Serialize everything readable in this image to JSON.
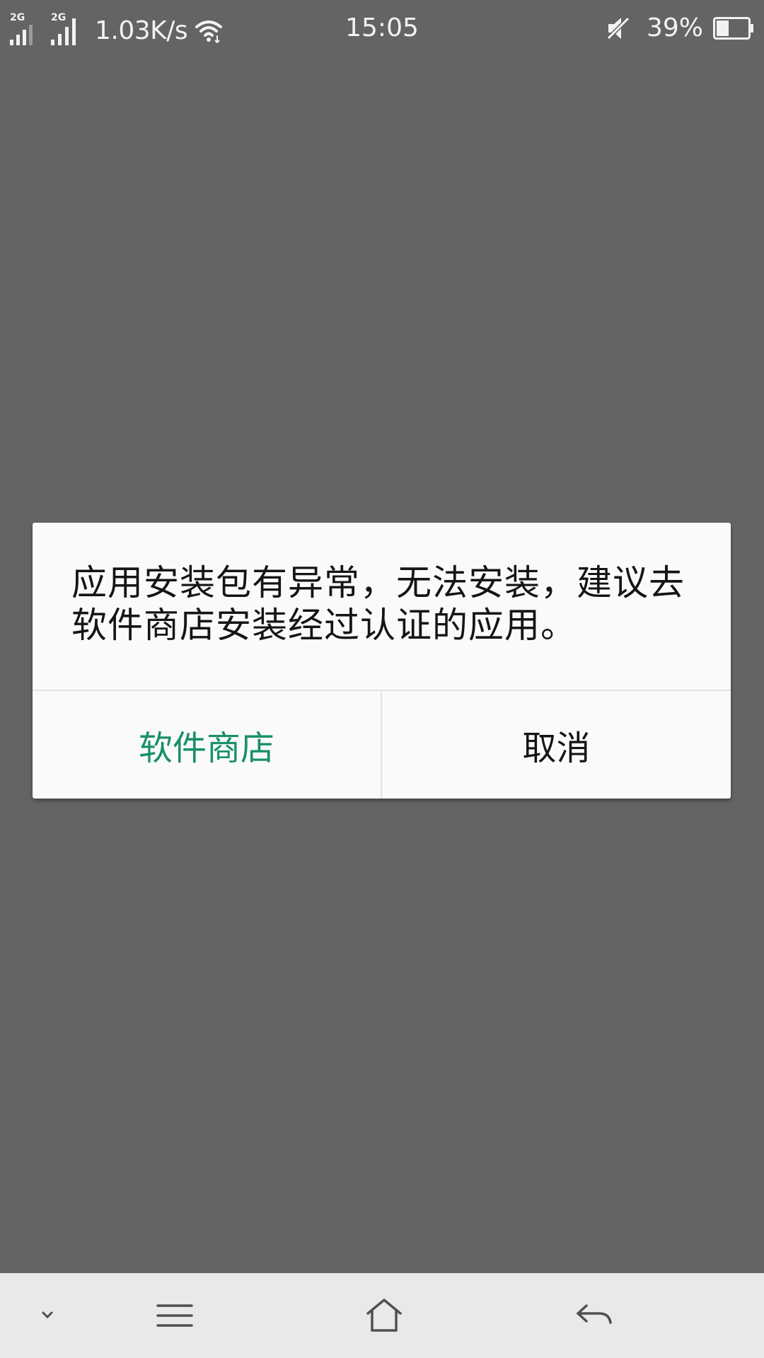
{
  "status_bar": {
    "sim1_network": "2G",
    "sim2_network": "2G",
    "net_speed": "1.03K/s",
    "time": "15:05",
    "battery_percent": "39%",
    "battery_level": 0.39,
    "icons": [
      "signal-icon",
      "wifi-icon",
      "mute-icon",
      "battery-icon"
    ]
  },
  "dialog": {
    "message": "应用安装包有异常，无法安装，建议去软件商店安装经过认证的应用。",
    "store_button": "软件商店",
    "cancel_button": "取消",
    "accent_color": "#1a9068"
  },
  "nav_bar": {
    "icons": [
      "collapse-chevron-icon",
      "menu-icon",
      "home-icon",
      "back-icon"
    ]
  },
  "colors": {
    "background": "#646464",
    "dialog": "#fafafa",
    "nav_bar": "#e9e9e9"
  }
}
